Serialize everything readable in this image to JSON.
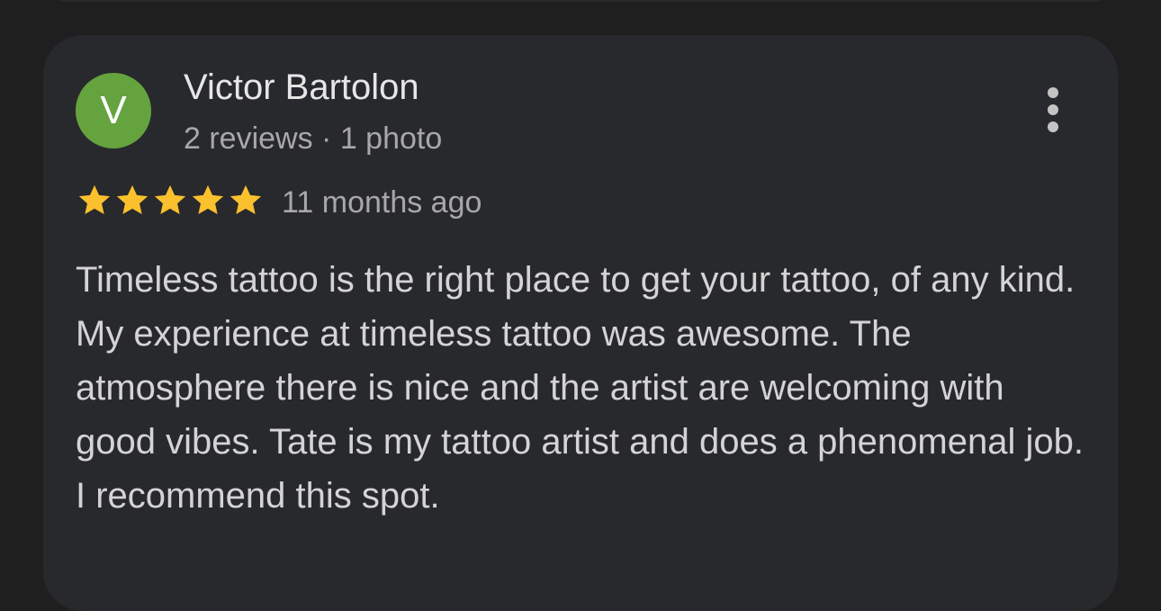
{
  "review": {
    "avatar_letter": "V",
    "avatar_color": "#64a33e",
    "author_name": "Victor Bartolon",
    "author_meta": "2 reviews · 1 photo",
    "rating": 5,
    "rating_max": 5,
    "star_color": "#fbc02d",
    "time_ago": "11 months ago",
    "text": "Timeless tattoo is the right place to get your tattoo, of any kind. My experience at timeless tattoo was awesome. The atmosphere there is nice and the artist are welcoming with good vibes. Tate is my tattoo artist and does a phenomenal job. I recommend this spot.",
    "more_icon": "more-vertical-icon"
  }
}
